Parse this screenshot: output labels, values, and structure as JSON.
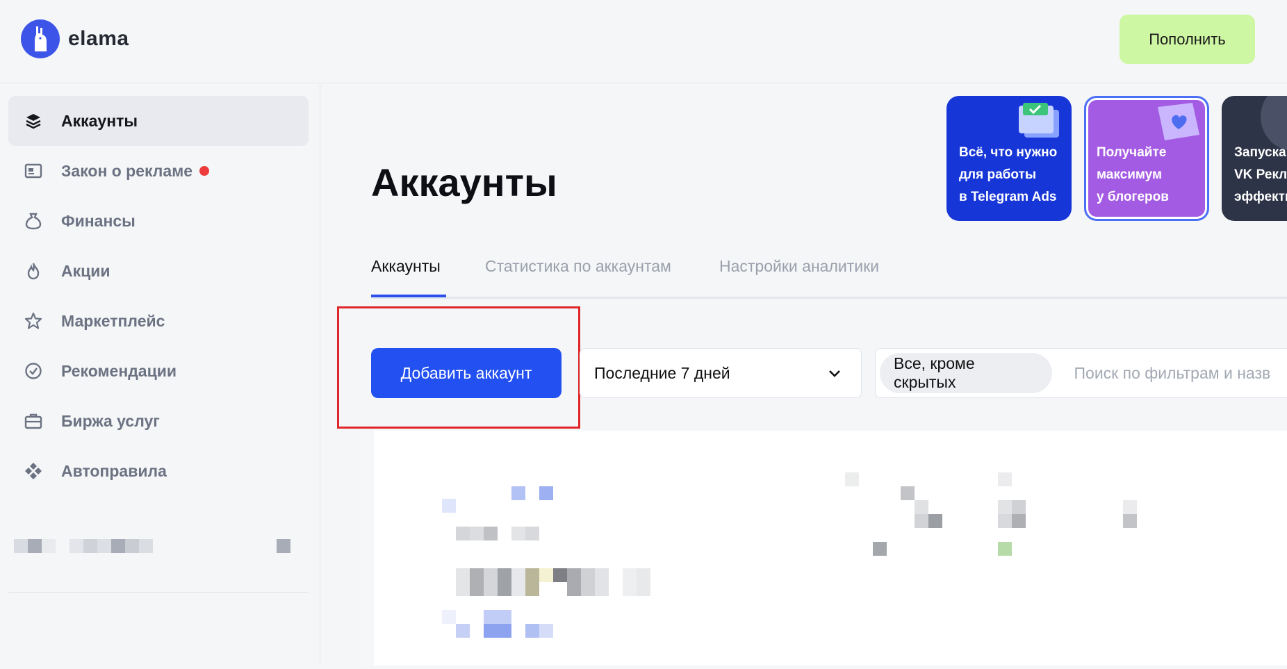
{
  "header": {
    "logo_text": "elama",
    "topup_label": "Пополнить"
  },
  "sidebar": {
    "items": [
      {
        "label": "Аккаунты",
        "icon": "layers-icon",
        "active": true
      },
      {
        "label": "Закон о рекламе",
        "icon": "ad-law-icon",
        "badge": "red-dot"
      },
      {
        "label": "Финансы",
        "icon": "money-bag-icon"
      },
      {
        "label": "Акции",
        "icon": "flame-icon"
      },
      {
        "label": "Маркетплейс",
        "icon": "star-icon"
      },
      {
        "label": "Рекомендации",
        "icon": "check-badge-icon"
      },
      {
        "label": "Биржа услуг",
        "icon": "briefcase-icon"
      },
      {
        "label": "Автоправила",
        "icon": "diamonds-icon"
      }
    ]
  },
  "page": {
    "title": "Аккаунты"
  },
  "promos": [
    {
      "line1": "Всё, что нужно",
      "line2": "для работы",
      "line3": "в Telegram Ads",
      "color": "#1736d8"
    },
    {
      "line1": "Получайте",
      "line2": "максимум",
      "line3": "у блогеров",
      "color": "#a45be3"
    },
    {
      "line1": "Запуска",
      "line2": "VK Рекл",
      "line3": "эффекти",
      "color": "#2e3447"
    }
  ],
  "tabs": [
    {
      "label": "Аккаунты",
      "active": true
    },
    {
      "label": "Статистика по аккаунтам"
    },
    {
      "label": "Настройки аналитики"
    }
  ],
  "toolbar": {
    "add_account_label": "Добавить аккаунт",
    "period_value": "Последние 7 дней",
    "filter_chip": "Все, кроме скрытых",
    "search_placeholder": "Поиск по фильтрам и назв"
  },
  "colors": {
    "accent": "#2350f0",
    "topup": "#cdf7a2",
    "highlight": "#e0262a",
    "badge_red": "#ec3c3c"
  }
}
